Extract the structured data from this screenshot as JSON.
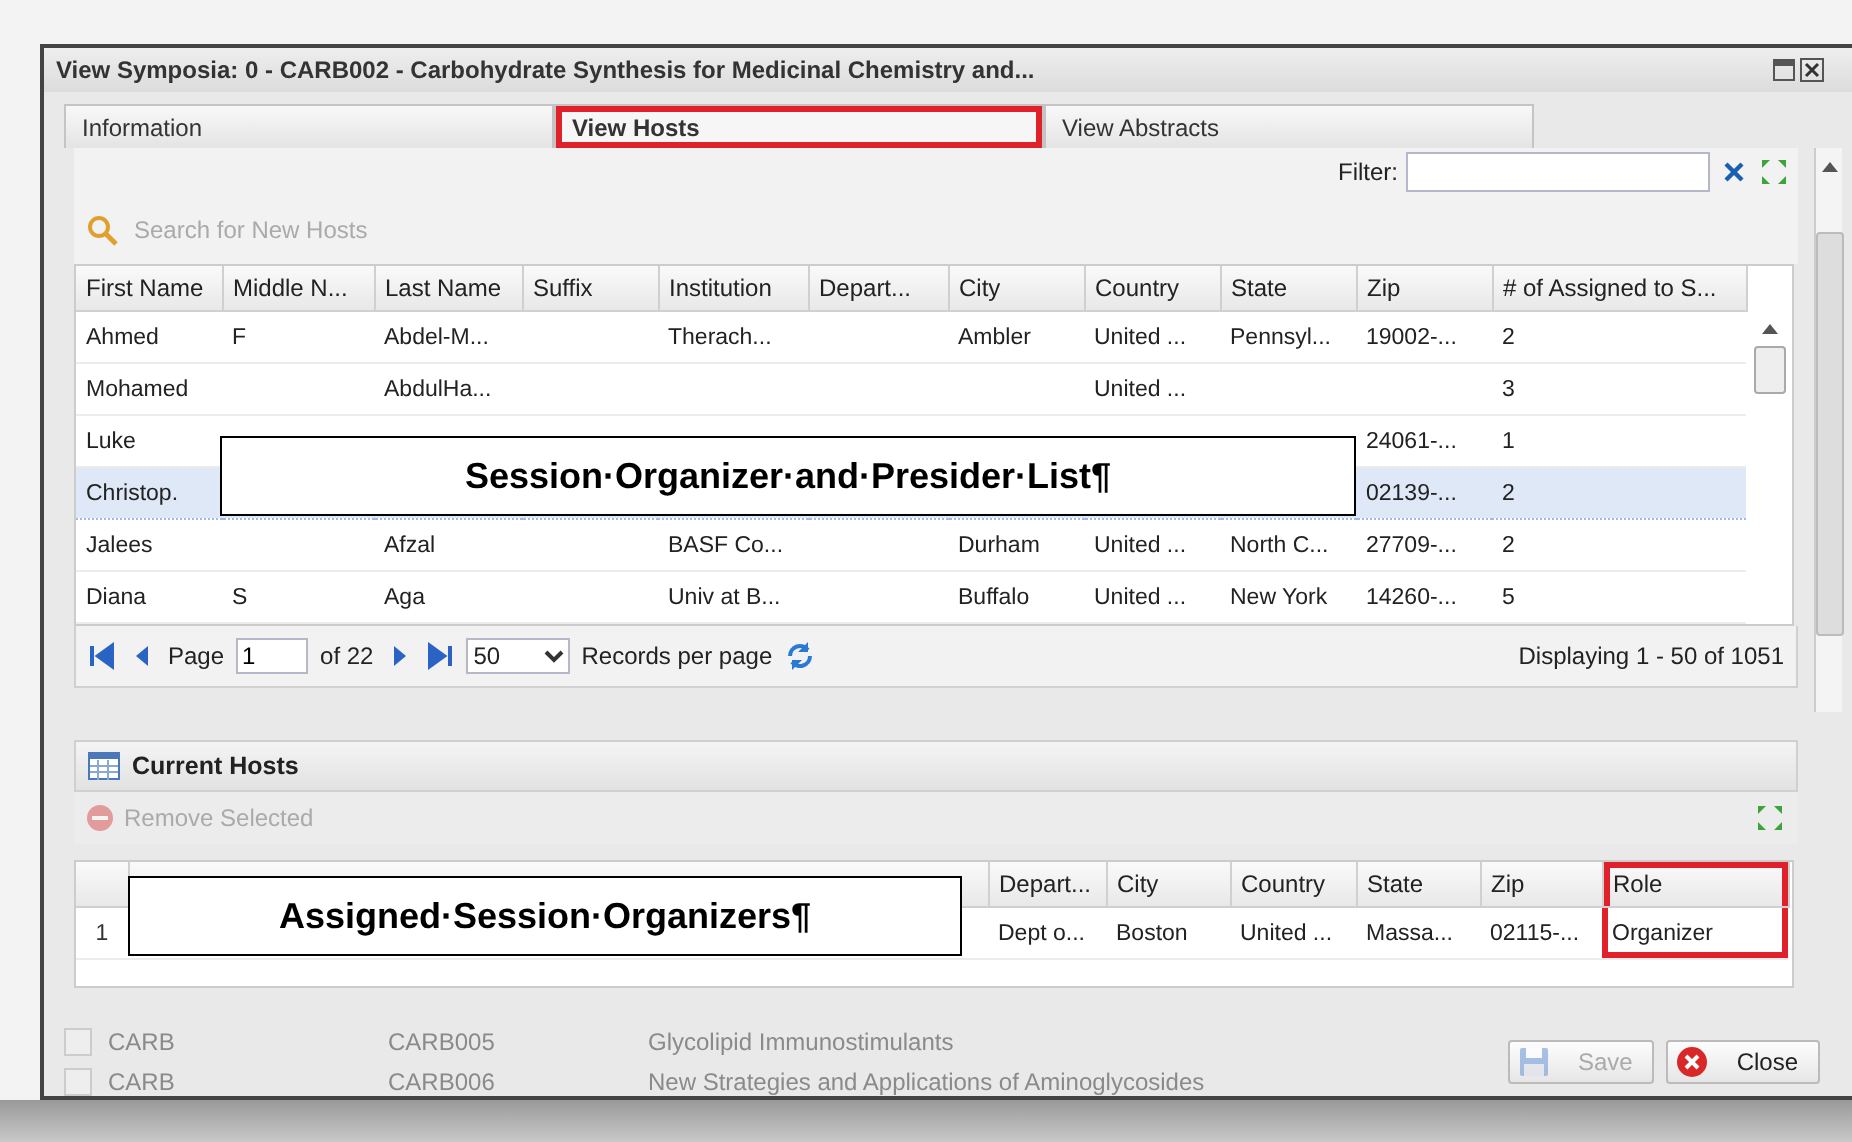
{
  "window": {
    "title": "View Symposia: 0 - CARB002 - Carbohydrate Synthesis for Medicinal Chemistry and..."
  },
  "tabs": [
    {
      "label": "Information",
      "selected": false,
      "highlighted": false
    },
    {
      "label": "View Hosts",
      "selected": true,
      "highlighted": true
    },
    {
      "label": "View Abstracts",
      "selected": false,
      "highlighted": false
    }
  ],
  "filter": {
    "label": "Filter:"
  },
  "search": {
    "placeholder": "Search for New Hosts"
  },
  "hosts_grid": {
    "columns": [
      "First Name",
      "Middle N...",
      "Last Name",
      "Suffix",
      "Institution",
      "Depart...",
      "City",
      "Country",
      "State",
      "Zip",
      "# of Assigned to S..."
    ],
    "rows": [
      {
        "selected": false,
        "cells": [
          "Ahmed",
          "F",
          "Abdel-M...",
          null,
          "Therach...",
          null,
          "Ambler",
          "United ...",
          "Pennsyl...",
          "19002-...",
          "2"
        ]
      },
      {
        "selected": false,
        "cells": [
          "Mohamed",
          null,
          "AbdulHa...",
          null,
          null,
          null,
          null,
          "United ...",
          null,
          null,
          "3"
        ]
      },
      {
        "selected": false,
        "cells": [
          "Luke",
          null,
          null,
          null,
          null,
          null,
          null,
          null,
          null,
          "24061-...",
          "1"
        ]
      },
      {
        "selected": true,
        "cells": [
          "Christop.",
          null,
          null,
          null,
          null,
          null,
          null,
          null,
          null,
          "02139-...",
          "2"
        ]
      },
      {
        "selected": false,
        "cells": [
          "Jalees",
          null,
          "Afzal",
          null,
          "BASF Co...",
          null,
          "Durham",
          "United ...",
          "North C...",
          "27709-...",
          "2"
        ]
      },
      {
        "selected": false,
        "cells": [
          "Diana",
          "S",
          "Aga",
          null,
          "Univ at B...",
          null,
          "Buffalo",
          "United ...",
          "New York",
          "14260-...",
          "5"
        ]
      }
    ]
  },
  "pager": {
    "page_label": "Page",
    "page": "1",
    "of": "of 22",
    "page_size": "50",
    "per_page_label": "Records per page",
    "summary": "Displaying 1 - 50 of 1051"
  },
  "current_hosts": {
    "title": "Current Hosts",
    "remove_button": {
      "label": "Remove Selected",
      "disabled": true
    },
    "columns": [
      {
        "label": "Depart...",
        "highlighted": false
      },
      {
        "label": "City",
        "highlighted": false
      },
      {
        "label": "Country",
        "highlighted": false
      },
      {
        "label": "State",
        "highlighted": false
      },
      {
        "label": "Zip",
        "highlighted": false
      },
      {
        "label": "Role",
        "highlighted": true
      }
    ],
    "rows": [
      {
        "number": "1",
        "cells": [
          "Dept o...",
          "Boston",
          "United ...",
          "Massa...",
          "02115-...",
          "Organizer"
        ]
      }
    ]
  },
  "background_rows": [
    {
      "checked": false,
      "cells": [
        "CARB",
        "CARB005",
        "Glycolipid Immunostimulants"
      ]
    },
    {
      "checked": false,
      "cells": [
        "CARB",
        "CARB006",
        "New Strategies and Applications of Aminoglycosides"
      ]
    }
  ],
  "buttons": [
    {
      "kind": "save",
      "label": "Save",
      "disabled": true
    },
    {
      "kind": "close",
      "label": "Close",
      "disabled": false
    }
  ],
  "annotations": [
    {
      "text": "Session·Organizer·and·Presider·List¶"
    },
    {
      "text": "Assigned·Session·Organizers¶"
    }
  ]
}
